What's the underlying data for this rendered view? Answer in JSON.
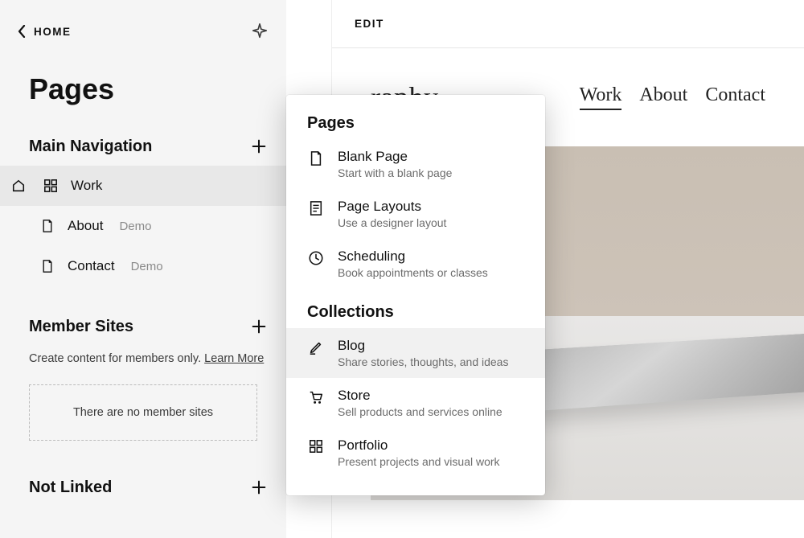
{
  "sidebar": {
    "home_label": "HOME",
    "title": "Pages",
    "sections": {
      "main_nav": {
        "title": "Main Navigation",
        "items": [
          {
            "label": "Work",
            "is_home": true,
            "icon": "grid"
          },
          {
            "label": "About",
            "tag": "Demo",
            "icon": "page"
          },
          {
            "label": "Contact",
            "tag": "Demo",
            "icon": "page"
          }
        ]
      },
      "member_sites": {
        "title": "Member Sites",
        "description": "Create content for members only.",
        "learn_more": "Learn More",
        "empty_text": "There are no member sites"
      },
      "not_linked": {
        "title": "Not Linked"
      }
    }
  },
  "popover": {
    "section_pages": "Pages",
    "section_collections": "Collections",
    "items": {
      "blank_page": {
        "title": "Blank Page",
        "desc": "Start with a blank page"
      },
      "page_layouts": {
        "title": "Page Layouts",
        "desc": "Use a designer layout"
      },
      "scheduling": {
        "title": "Scheduling",
        "desc": "Book appointments or classes"
      },
      "blog": {
        "title": "Blog",
        "desc": "Share stories, thoughts, and ideas"
      },
      "store": {
        "title": "Store",
        "desc": "Sell products and services online"
      },
      "portfolio": {
        "title": "Portfolio",
        "desc": "Present projects and visual work"
      }
    }
  },
  "preview": {
    "edit_label": "EDIT",
    "site_logo_fragment": "raphy",
    "nav": {
      "work": "Work",
      "about": "About",
      "contact": "Contact"
    }
  }
}
